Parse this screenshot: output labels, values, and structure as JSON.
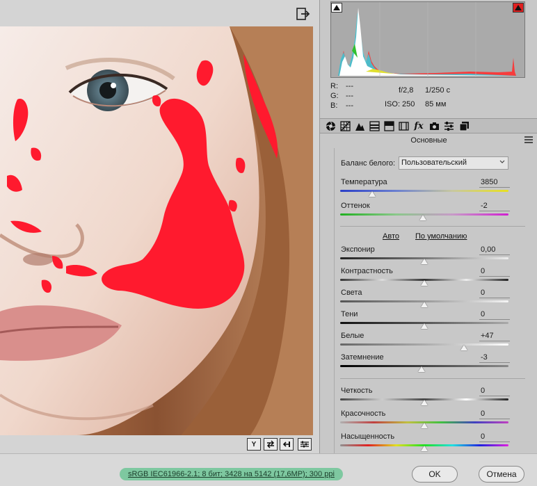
{
  "preview": {
    "view_buttons": [
      "Y",
      "",
      "",
      ""
    ]
  },
  "histogram": {
    "readout": {
      "r_label": "R:",
      "r_value": "---",
      "g_label": "G:",
      "g_value": "---",
      "b_label": "B:",
      "b_value": "---",
      "aperture": "f/2,8",
      "shutter": "1/250 с",
      "iso": "ISO: 250",
      "focal": "85 мм"
    }
  },
  "tabs": [
    "basic-icon",
    "tone-curve-icon",
    "detail-icon",
    "hsl-icon",
    "split-toning-icon",
    "lens-icon",
    "fx-icon",
    "camera-calibration-icon",
    "presets-icon",
    "snapshots-icon"
  ],
  "panel": {
    "section_title": "Основные",
    "white_balance_label": "Баланс белого:",
    "white_balance_value": "Пользовательский",
    "auto_link": "Авто",
    "default_link": "По умолчанию"
  },
  "sliders": [
    {
      "label": "Температура",
      "value": "3850",
      "level": 0.19,
      "gradient": "linear-gradient(to right,#2a3fc8,#6a7fd0,#c8c8a0,#e8e020)"
    },
    {
      "label": "Оттенок",
      "value": "-2",
      "level": 0.49,
      "gradient": "linear-gradient(to right,#20b020,#8ac88a,#c89ac8,#d020d0)"
    },
    {
      "label": "Экспонир",
      "value": "0,00",
      "level": 0.5,
      "gradient": "linear-gradient(to right,#222,#777,#eee)"
    },
    {
      "label": "Контрастность",
      "value": "0",
      "level": 0.5,
      "gradient": "linear-gradient(to right,#333,#ddd,#333,#eee,#222)"
    },
    {
      "label": "Света",
      "value": "0",
      "level": 0.5,
      "gradient": "linear-gradient(to right,#555,#999,#f5f5f5)"
    },
    {
      "label": "Тени",
      "value": "0",
      "level": 0.5,
      "gradient": "linear-gradient(to right,#111,#555,#aaa)"
    },
    {
      "label": "Белые",
      "value": "+47",
      "level": 0.735,
      "gradient": "linear-gradient(to right,#666,#aaa,#fff)"
    },
    {
      "label": "Затемнение",
      "value": "-3",
      "level": 0.485,
      "gradient": "linear-gradient(to right,#000,#444,#888)"
    },
    {
      "label": "Четкость",
      "value": "0",
      "level": 0.5,
      "gradient": "linear-gradient(to right,#444,#ccc,#444,#fff,#222)"
    },
    {
      "label": "Красочность",
      "value": "0",
      "level": 0.5,
      "gradient": "linear-gradient(to right,#b0b0b0,#c04040,#c0c040,#40c040,#4040c0,#c040c0)"
    },
    {
      "label": "Насыщенность",
      "value": "0",
      "level": 0.5,
      "gradient": "linear-gradient(to right,#909090,#e02020,#e0e020,#20e020,#20e0e0,#2020e0,#e020e0)"
    }
  ],
  "footer": {
    "info": "sRGB IEC61966-2.1; 8 бит; 3428 на 5142 (17,6MP); 300 ppi",
    "ok_label": "OK",
    "cancel_label": "Отмена"
  },
  "colors": {
    "clipping_overlay": "#ff1a2e",
    "histogram_bg": "#aaaaaa",
    "info_pill": "#7ec8a0"
  }
}
